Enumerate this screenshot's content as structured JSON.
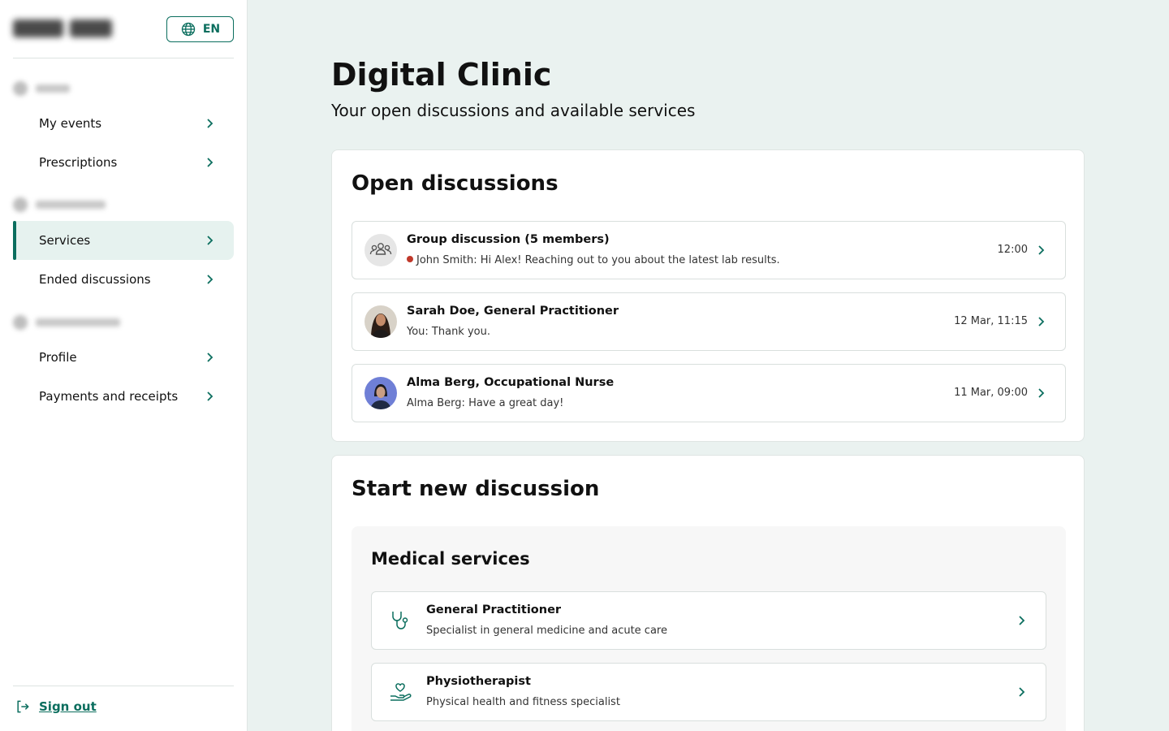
{
  "colors": {
    "accent": "#0b6e5e",
    "background": "#eaf2f0",
    "active_nav": "#e6f2ef",
    "unread": "#c0392b"
  },
  "header": {
    "language": "EN"
  },
  "sidebar": {
    "items": [
      {
        "label": "My events"
      },
      {
        "label": "Prescriptions"
      },
      {
        "label": "Services",
        "active": true
      },
      {
        "label": "Ended discussions"
      },
      {
        "label": "Profile"
      },
      {
        "label": "Payments and receipts"
      }
    ],
    "signout_label": "Sign out"
  },
  "main": {
    "title": "Digital Clinic",
    "subtitle": "Your open discussions and available services"
  },
  "open_discussions": {
    "title": "Open discussions",
    "items": [
      {
        "name": "Group discussion (5 members)",
        "message": "John Smith: Hi Alex! Reaching out to you about the latest lab results.",
        "time": "12:00",
        "unread": true,
        "avatar": "group-icon"
      },
      {
        "name": "Sarah Doe, General Practitioner",
        "message": "You: Thank you.",
        "time": "12 Mar, 11:15",
        "avatar": "photo"
      },
      {
        "name": "Alma Berg, Occupational Nurse",
        "message": "Alma Berg: Have a great day!",
        "time": "11 Mar, 09:00",
        "avatar": "photo"
      }
    ]
  },
  "new_discussion": {
    "title": "Start new discussion",
    "section_title": "Medical services",
    "services": [
      {
        "name": "General Practitioner",
        "description": "Specialist in general medicine and acute care",
        "icon": "stethoscope-icon"
      },
      {
        "name": "Physiotherapist",
        "description": "Physical health and fitness specialist",
        "icon": "heart-hand-icon"
      }
    ]
  }
}
